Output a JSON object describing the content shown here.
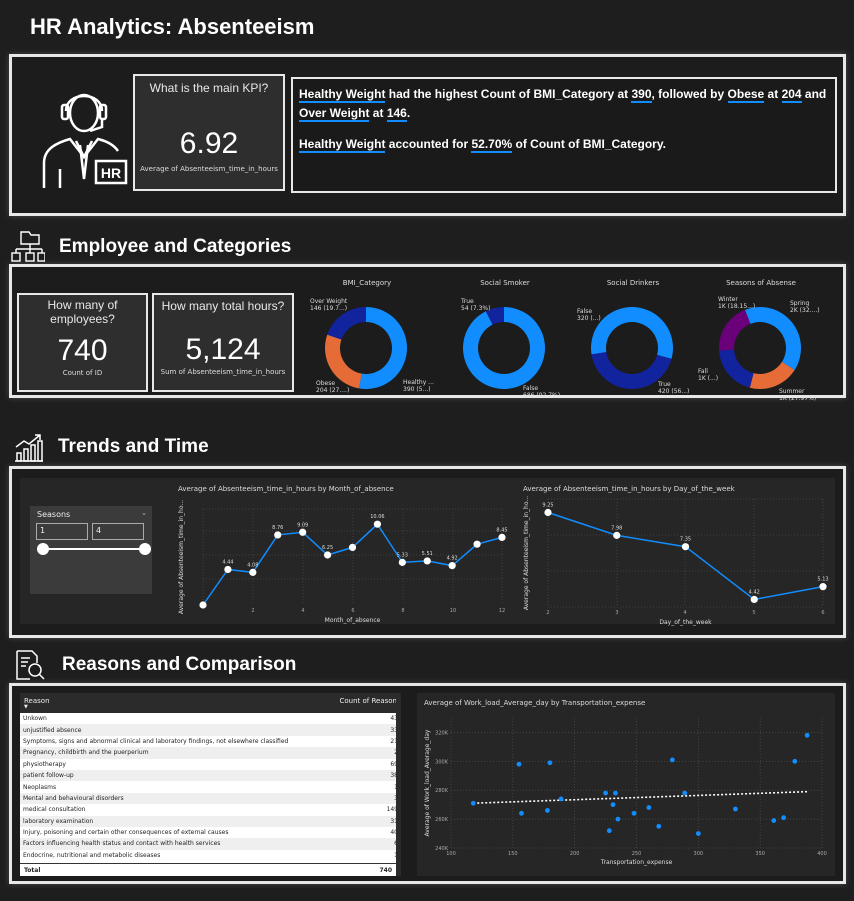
{
  "title": "HR Analytics: Absenteeism",
  "kpi_main": {
    "question": "What is the main KPI?",
    "value": "6.92",
    "label": "Average of Absenteeism_time_in_hours"
  },
  "narrative": {
    "p1": [
      {
        "t": "Healthy Weight",
        "u": true
      },
      {
        "t": " had the highest Count of BMI_Category at ",
        "u": false
      },
      {
        "t": "390",
        "u": true
      },
      {
        "t": ", followed by ",
        "u": false
      },
      {
        "t": "Obese",
        "u": true
      },
      {
        "t": " at ",
        "u": false
      },
      {
        "t": "204",
        "u": true
      },
      {
        "t": " and ",
        "u": false
      },
      {
        "t": "Over Weight",
        "u": true
      },
      {
        "t": " at ",
        "u": false
      },
      {
        "t": "146",
        "u": true
      },
      {
        "t": ".",
        "u": false
      }
    ],
    "p2": [
      {
        "t": "Healthy Weight",
        "u": true
      },
      {
        "t": " accounted for ",
        "u": false
      },
      {
        "t": "52.70%",
        "u": true
      },
      {
        "t": " of Count of BMI_Category.",
        "u": false
      }
    ]
  },
  "sections": {
    "employee": "Employee and Categories",
    "trends": "Trends and Time",
    "reasons": "Reasons and Comparison"
  },
  "kpi_employees": {
    "question": "How many of employees?",
    "value": "740",
    "label": "Count of ID"
  },
  "kpi_hours": {
    "question": "How many total hours?",
    "value": "5,124",
    "label": "Sum of Absenteeism_time_in_hours"
  },
  "slicer": {
    "title": "Seasons",
    "min": "1",
    "max": "4",
    "chevron": "chevron-down-icon"
  },
  "colors": {
    "blue": "#118dff",
    "navy": "#12239e",
    "orange": "#e66c37",
    "purple": "#6b007b",
    "teal": "#1aab40"
  },
  "chart_data": [
    {
      "type": "pie",
      "title": "BMI_Category",
      "slices": [
        {
          "name": "Healthy ...",
          "value": 390,
          "label": "390 (5...)",
          "color": "#118dff"
        },
        {
          "name": "Obese",
          "value": 204,
          "label": "204 (27....)",
          "color": "#e66c37"
        },
        {
          "name": "Over Weight",
          "value": 146,
          "label": "146 (19.7...)",
          "color": "#12239e"
        }
      ]
    },
    {
      "type": "pie",
      "title": "Social Smoker",
      "slices": [
        {
          "name": "False",
          "value": 686,
          "label": "686 (92.7%)",
          "color": "#118dff"
        },
        {
          "name": "True",
          "value": 54,
          "label": "54 (7.3%)",
          "color": "#12239e"
        }
      ]
    },
    {
      "type": "pie",
      "title": "Social Drinkers",
      "slices": [
        {
          "name": "True",
          "value": 420,
          "label": "420 (56...)",
          "color": "#118dff"
        },
        {
          "name": "False",
          "value": 320,
          "label": "320 (...)",
          "color": "#12239e"
        }
      ]
    },
    {
      "type": "pie",
      "title": "Seasons of Absense",
      "slices": [
        {
          "name": "Spring",
          "value": 2,
          "label": "2K (32....)",
          "color": "#118dff"
        },
        {
          "name": "Summer",
          "value": 1,
          "label": "1K (27.97%)",
          "color": "#e66c37"
        },
        {
          "name": "Fall",
          "value": 1,
          "label": "1K (...)",
          "color": "#12239e"
        },
        {
          "name": "Winter",
          "value": 1,
          "label": "1K (18.15...)",
          "color": "#6b007b"
        }
      ]
    },
    {
      "type": "line",
      "title": "Average of Absenteeism_time_in_hours by Month_of_absence",
      "xlabel": "Month_of_absence",
      "ylabel": "Average of Absenteeism_time_in_ho...",
      "x": [
        0,
        1,
        2,
        3,
        4,
        5,
        6,
        7,
        8,
        9,
        10,
        11,
        12
      ],
      "y": [
        0.0,
        4.44,
        4.08,
        8.76,
        9.09,
        6.25,
        7.2,
        10.1,
        5.33,
        5.51,
        4.92,
        7.6,
        8.45
      ],
      "labels": [
        "",
        "4.44",
        "4.08",
        "8.76",
        "9.09",
        "6.25",
        "",
        "10.06",
        "5.33",
        "5.51",
        "4.92",
        "",
        "8.45"
      ],
      "xticks": [
        "",
        "2",
        "4",
        "6",
        "8",
        "10",
        "12"
      ],
      "ylim": [
        0,
        12
      ]
    },
    {
      "type": "line",
      "title": "Average of Absenteeism_time_in_hours by Day_of_the_week",
      "xlabel": "Day_of_the_week",
      "ylabel": "Average of Absenteeism_time_in_ho...",
      "x": [
        2,
        3,
        4,
        5,
        6
      ],
      "y": [
        9.25,
        7.98,
        7.35,
        4.42,
        5.13
      ],
      "labels": [
        "9.25",
        "7.98",
        "7.35",
        "4.42",
        "5.13"
      ],
      "xticks": [
        "2",
        "3",
        "4",
        "5",
        "6"
      ],
      "yticks": [
        "",
        "5",
        "",
        "10"
      ],
      "ylim": [
        4,
        10
      ]
    },
    {
      "type": "table",
      "columns": [
        "Reason",
        "Count of Reason"
      ],
      "rows": [
        [
          "Unkown",
          "43"
        ],
        [
          "unjustified absence",
          "33"
        ],
        [
          "Symptoms, signs and abnormal clinical and laboratory findings, not elsewhere classified",
          "21"
        ],
        [
          "Pregnancy, childbirth and the puerperium",
          "2"
        ],
        [
          "physiotherapy",
          "69"
        ],
        [
          "patient follow-up",
          "38"
        ],
        [
          "Neoplasms",
          "1"
        ],
        [
          "Mental and behavioural disorders",
          "3"
        ],
        [
          "medical consultation",
          "149"
        ],
        [
          "laboratory examination",
          "31"
        ],
        [
          "Injury, poisoning and certain other consequences of external causes",
          "40"
        ],
        [
          "Factors influencing health status and contact with health services",
          "6"
        ],
        [
          "Endocrine, nutritional and metabolic diseases",
          "1"
        ]
      ],
      "total": [
        "Total",
        "740"
      ]
    },
    {
      "type": "scatter",
      "title": "Average of Work_load_Average_day by Transportation_expense",
      "xlabel": "Transportation_expense",
      "ylabel": "Average of Work_load_Average_day",
      "xlim": [
        100,
        400
      ],
      "ylim": [
        240,
        330
      ],
      "xticks": [
        "100",
        "150",
        "200",
        "250",
        "300",
        "350",
        "400"
      ],
      "yticks": [
        "240K",
        "260K",
        "280K",
        "300K",
        "320K"
      ],
      "points": [
        [
          118,
          271
        ],
        [
          155,
          298
        ],
        [
          157,
          264
        ],
        [
          178,
          266
        ],
        [
          180,
          299
        ],
        [
          189,
          274
        ],
        [
          225,
          278
        ],
        [
          228,
          252
        ],
        [
          231,
          270
        ],
        [
          233,
          278
        ],
        [
          235,
          260
        ],
        [
          248,
          264
        ],
        [
          260,
          268
        ],
        [
          268,
          255
        ],
        [
          279,
          301
        ],
        [
          289,
          278
        ],
        [
          300,
          250
        ],
        [
          330,
          267
        ],
        [
          361,
          259
        ],
        [
          369,
          261
        ],
        [
          378,
          300
        ],
        [
          388,
          318
        ]
      ],
      "trend": [
        [
          118,
          271
        ],
        [
          388,
          279
        ]
      ]
    }
  ]
}
